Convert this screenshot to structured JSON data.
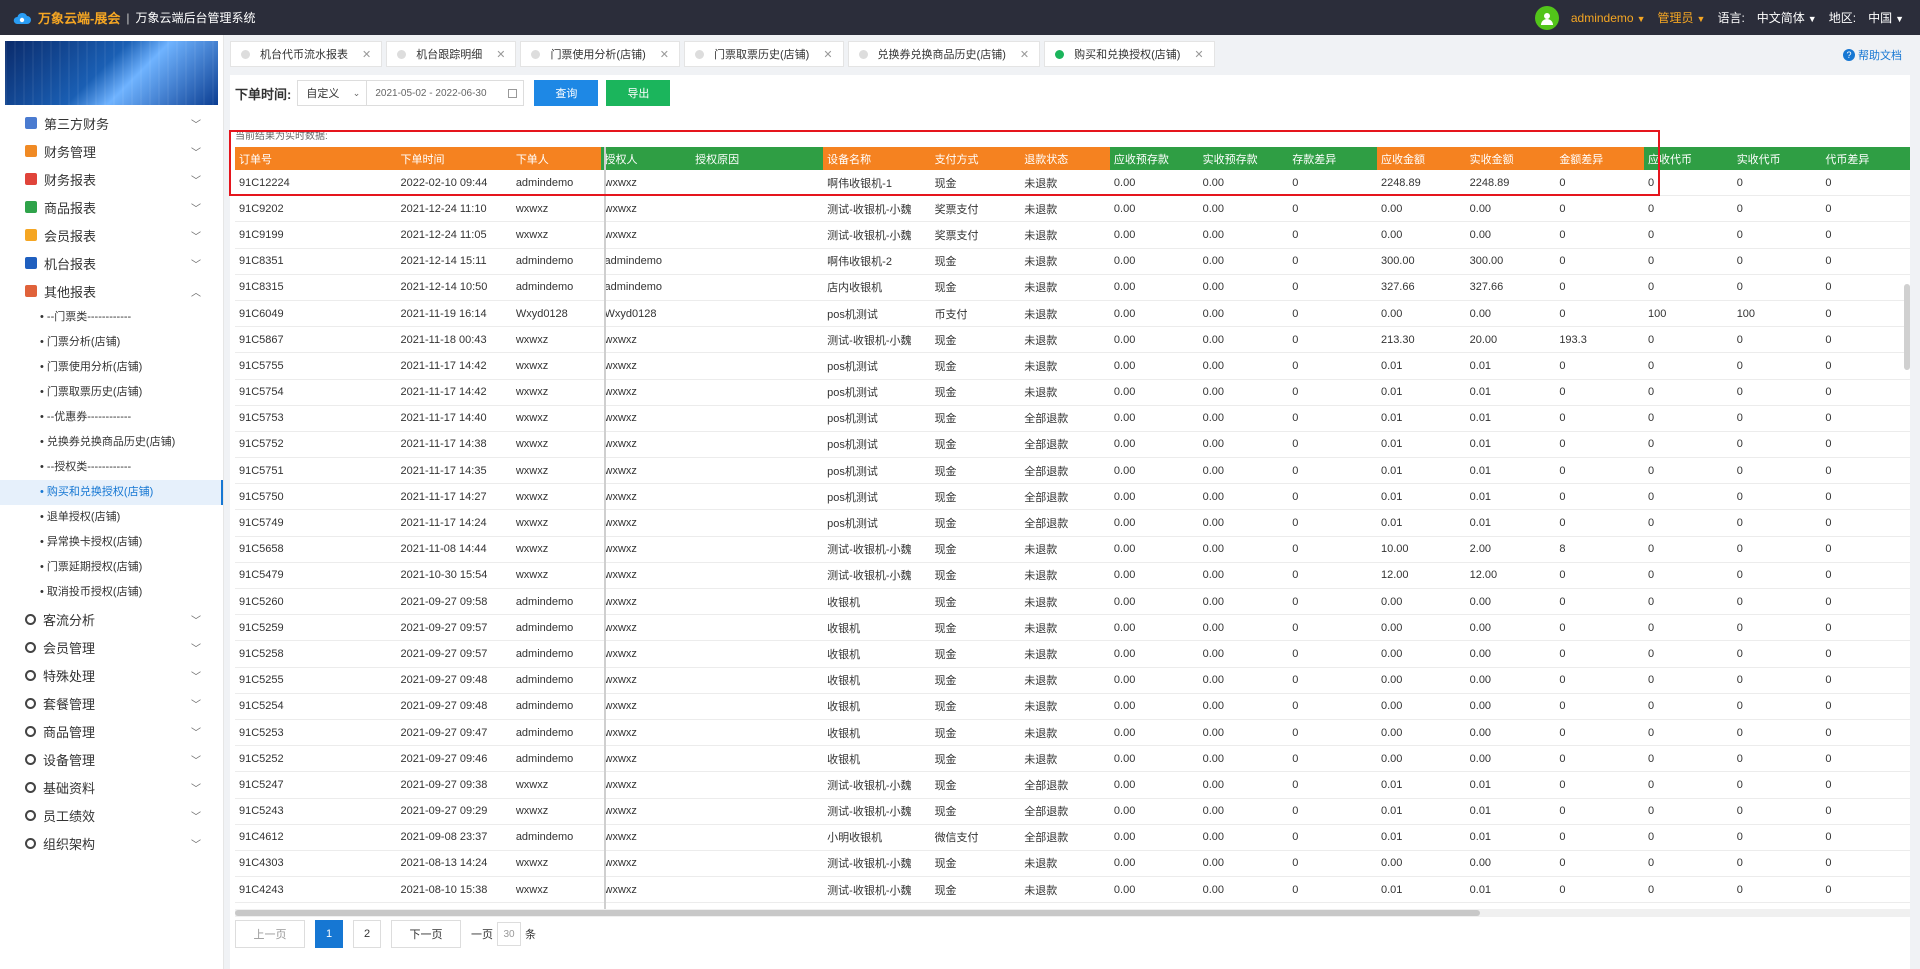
{
  "header": {
    "brand": "万象云端-展会",
    "separator": "|",
    "system_name": "万象云端后台管理系统",
    "username": "admindemo",
    "role": "管理员",
    "language_label": "语言:",
    "language_value": "中文简体",
    "region_label": "地区:",
    "region_value": "中国"
  },
  "sidebar": {
    "menu_top": [
      {
        "label": "第三方财务",
        "icon": "finance-third-icon",
        "color": "#4a7bd0"
      },
      {
        "label": "财务管理",
        "icon": "finance-manage-icon",
        "color": "#f08a24"
      },
      {
        "label": "财务报表",
        "icon": "finance-report-icon",
        "color": "#e0443a"
      },
      {
        "label": "商品报表",
        "icon": "product-report-icon",
        "color": "#2fa34a"
      },
      {
        "label": "会员报表",
        "icon": "member-report-icon",
        "color": "#f5a623"
      },
      {
        "label": "机台报表",
        "icon": "machine-report-icon",
        "color": "#1f5fbf"
      },
      {
        "label": "其他报表",
        "icon": "other-report-icon",
        "color": "#e0623a"
      }
    ],
    "sub_items": [
      {
        "label": "• --门票类------------",
        "active": false
      },
      {
        "label": "• 门票分析(店铺)",
        "active": false
      },
      {
        "label": "• 门票使用分析(店铺)",
        "active": false
      },
      {
        "label": "• 门票取票历史(店铺)",
        "active": false
      },
      {
        "label": "• --优惠券------------",
        "active": false
      },
      {
        "label": "• 兑换券兑换商品历史(店铺)",
        "active": false
      },
      {
        "label": "• --授权类------------",
        "active": false
      },
      {
        "label": "• 购买和兑换授权(店铺)",
        "active": true
      },
      {
        "label": "• 退单授权(店铺)",
        "active": false
      },
      {
        "label": "• 异常换卡授权(店铺)",
        "active": false
      },
      {
        "label": "• 门票延期授权(店铺)",
        "active": false
      },
      {
        "label": "• 取消投币授权(店铺)",
        "active": false
      }
    ],
    "menu_bottom": [
      {
        "label": "客流分析",
        "icon": "traffic-icon"
      },
      {
        "label": "会员管理",
        "icon": "member-icon"
      },
      {
        "label": "特殊处理",
        "icon": "warning-icon"
      },
      {
        "label": "套餐管理",
        "icon": "package-icon"
      },
      {
        "label": "商品管理",
        "icon": "product-icon"
      },
      {
        "label": "设备管理",
        "icon": "device-icon"
      },
      {
        "label": "基础资料",
        "icon": "data-icon"
      },
      {
        "label": "员工绩效",
        "icon": "staff-icon"
      },
      {
        "label": "组织架构",
        "icon": "org-icon"
      }
    ]
  },
  "tabs": [
    {
      "label": "机台代币流水报表",
      "active": false
    },
    {
      "label": "机台跟踪明细",
      "active": false
    },
    {
      "label": "门票使用分析(店铺)",
      "active": false
    },
    {
      "label": "门票取票历史(店铺)",
      "active": false
    },
    {
      "label": "兑换券兑换商品历史(店铺)",
      "active": false
    },
    {
      "label": "购买和兑换授权(店铺)",
      "active": true
    }
  ],
  "help_label": "帮助文档",
  "filter": {
    "label": "下单时间:",
    "mode": "自定义",
    "date_range": "2021-05-02 - 2022-06-30",
    "query_label": "查询",
    "export_label": "导出"
  },
  "note": "当前结果为实时数据:",
  "colors": {
    "orange": "#f58220",
    "green": "#2f9e44",
    "primary": "#1677d3",
    "highlight": "#e5151d"
  },
  "table": {
    "columns": [
      {
        "label": "订单号",
        "color": "o"
      },
      {
        "label": "下单时间",
        "color": "o"
      },
      {
        "label": "下单人",
        "color": "o"
      },
      {
        "label": "授权人",
        "color": "g"
      },
      {
        "label": "授权原因",
        "color": "g"
      },
      {
        "label": "设备名称",
        "color": "o"
      },
      {
        "label": "支付方式",
        "color": "o"
      },
      {
        "label": "退款状态",
        "color": "o"
      },
      {
        "label": "应收预存款",
        "color": "g"
      },
      {
        "label": "实收预存款",
        "color": "g"
      },
      {
        "label": "存款差异",
        "color": "g"
      },
      {
        "label": "应收金额",
        "color": "o"
      },
      {
        "label": "实收金额",
        "color": "o"
      },
      {
        "label": "金额差异",
        "color": "o"
      },
      {
        "label": "应收代币",
        "color": "g"
      },
      {
        "label": "实收代币",
        "color": "g"
      },
      {
        "label": "代币差异",
        "color": "g"
      }
    ],
    "rows": [
      [
        "91C12224",
        "2022-02-10 09:44",
        "admindemo",
        "wxwxz",
        "",
        "啊伟收银机-1",
        "现金",
        "未退款",
        "0.00",
        "0.00",
        "0",
        "2248.89",
        "2248.89",
        "0",
        "0",
        "0",
        "0"
      ],
      [
        "91C9202",
        "2021-12-24 11:10",
        "wxwxz",
        "wxwxz",
        "",
        "测试-收银机-小魏",
        "奖票支付",
        "未退款",
        "0.00",
        "0.00",
        "0",
        "0.00",
        "0.00",
        "0",
        "0",
        "0",
        "0"
      ],
      [
        "91C9199",
        "2021-12-24 11:05",
        "wxwxz",
        "wxwxz",
        "",
        "测试-收银机-小魏",
        "奖票支付",
        "未退款",
        "0.00",
        "0.00",
        "0",
        "0.00",
        "0.00",
        "0",
        "0",
        "0",
        "0"
      ],
      [
        "91C8351",
        "2021-12-14 15:11",
        "admindemo",
        "admindemo",
        "",
        "啊伟收银机-2",
        "现金",
        "未退款",
        "0.00",
        "0.00",
        "0",
        "300.00",
        "300.00",
        "0",
        "0",
        "0",
        "0"
      ],
      [
        "91C8315",
        "2021-12-14 10:50",
        "admindemo",
        "admindemo",
        "",
        "店内收银机",
        "现金",
        "未退款",
        "0.00",
        "0.00",
        "0",
        "327.66",
        "327.66",
        "0",
        "0",
        "0",
        "0"
      ],
      [
        "91C6049",
        "2021-11-19 16:14",
        "Wxyd0128",
        "Wxyd0128",
        "",
        "pos机测试",
        "币支付",
        "未退款",
        "0.00",
        "0.00",
        "0",
        "0.00",
        "0.00",
        "0",
        "100",
        "100",
        "0"
      ],
      [
        "91C5867",
        "2021-11-18 00:43",
        "wxwxz",
        "wxwxz",
        "",
        "测试-收银机-小魏",
        "现金",
        "未退款",
        "0.00",
        "0.00",
        "0",
        "213.30",
        "20.00",
        "193.3",
        "0",
        "0",
        "0"
      ],
      [
        "91C5755",
        "2021-11-17 14:42",
        "wxwxz",
        "wxwxz",
        "",
        "pos机测试",
        "现金",
        "未退款",
        "0.00",
        "0.00",
        "0",
        "0.01",
        "0.01",
        "0",
        "0",
        "0",
        "0"
      ],
      [
        "91C5754",
        "2021-11-17 14:42",
        "wxwxz",
        "wxwxz",
        "",
        "pos机测试",
        "现金",
        "未退款",
        "0.00",
        "0.00",
        "0",
        "0.01",
        "0.01",
        "0",
        "0",
        "0",
        "0"
      ],
      [
        "91C5753",
        "2021-11-17 14:40",
        "wxwxz",
        "wxwxz",
        "",
        "pos机测试",
        "现金",
        "全部退款",
        "0.00",
        "0.00",
        "0",
        "0.01",
        "0.01",
        "0",
        "0",
        "0",
        "0"
      ],
      [
        "91C5752",
        "2021-11-17 14:38",
        "wxwxz",
        "wxwxz",
        "",
        "pos机测试",
        "现金",
        "全部退款",
        "0.00",
        "0.00",
        "0",
        "0.01",
        "0.01",
        "0",
        "0",
        "0",
        "0"
      ],
      [
        "91C5751",
        "2021-11-17 14:35",
        "wxwxz",
        "wxwxz",
        "",
        "pos机测试",
        "现金",
        "全部退款",
        "0.00",
        "0.00",
        "0",
        "0.01",
        "0.01",
        "0",
        "0",
        "0",
        "0"
      ],
      [
        "91C5750",
        "2021-11-17 14:27",
        "wxwxz",
        "wxwxz",
        "",
        "pos机测试",
        "现金",
        "全部退款",
        "0.00",
        "0.00",
        "0",
        "0.01",
        "0.01",
        "0",
        "0",
        "0",
        "0"
      ],
      [
        "91C5749",
        "2021-11-17 14:24",
        "wxwxz",
        "wxwxz",
        "",
        "pos机测试",
        "现金",
        "全部退款",
        "0.00",
        "0.00",
        "0",
        "0.01",
        "0.01",
        "0",
        "0",
        "0",
        "0"
      ],
      [
        "91C5658",
        "2021-11-08 14:44",
        "wxwxz",
        "wxwxz",
        "",
        "测试-收银机-小魏",
        "现金",
        "未退款",
        "0.00",
        "0.00",
        "0",
        "10.00",
        "2.00",
        "8",
        "0",
        "0",
        "0"
      ],
      [
        "91C5479",
        "2021-10-30 15:54",
        "wxwxz",
        "wxwxz",
        "",
        "测试-收银机-小魏",
        "现金",
        "未退款",
        "0.00",
        "0.00",
        "0",
        "12.00",
        "12.00",
        "0",
        "0",
        "0",
        "0"
      ],
      [
        "91C5260",
        "2021-09-27 09:58",
        "admindemo",
        "wxwxz",
        "",
        "收银机",
        "现金",
        "未退款",
        "0.00",
        "0.00",
        "0",
        "0.00",
        "0.00",
        "0",
        "0",
        "0",
        "0"
      ],
      [
        "91C5259",
        "2021-09-27 09:57",
        "admindemo",
        "wxwxz",
        "",
        "收银机",
        "现金",
        "未退款",
        "0.00",
        "0.00",
        "0",
        "0.00",
        "0.00",
        "0",
        "0",
        "0",
        "0"
      ],
      [
        "91C5258",
        "2021-09-27 09:57",
        "admindemo",
        "wxwxz",
        "",
        "收银机",
        "现金",
        "未退款",
        "0.00",
        "0.00",
        "0",
        "0.00",
        "0.00",
        "0",
        "0",
        "0",
        "0"
      ],
      [
        "91C5255",
        "2021-09-27 09:48",
        "admindemo",
        "wxwxz",
        "",
        "收银机",
        "现金",
        "未退款",
        "0.00",
        "0.00",
        "0",
        "0.00",
        "0.00",
        "0",
        "0",
        "0",
        "0"
      ],
      [
        "91C5254",
        "2021-09-27 09:48",
        "admindemo",
        "wxwxz",
        "",
        "收银机",
        "现金",
        "未退款",
        "0.00",
        "0.00",
        "0",
        "0.00",
        "0.00",
        "0",
        "0",
        "0",
        "0"
      ],
      [
        "91C5253",
        "2021-09-27 09:47",
        "admindemo",
        "wxwxz",
        "",
        "收银机",
        "现金",
        "未退款",
        "0.00",
        "0.00",
        "0",
        "0.00",
        "0.00",
        "0",
        "0",
        "0",
        "0"
      ],
      [
        "91C5252",
        "2021-09-27 09:46",
        "admindemo",
        "wxwxz",
        "",
        "收银机",
        "现金",
        "未退款",
        "0.00",
        "0.00",
        "0",
        "0.00",
        "0.00",
        "0",
        "0",
        "0",
        "0"
      ],
      [
        "91C5247",
        "2021-09-27 09:38",
        "wxwxz",
        "wxwxz",
        "",
        "测试-收银机-小魏",
        "现金",
        "全部退款",
        "0.00",
        "0.00",
        "0",
        "0.01",
        "0.01",
        "0",
        "0",
        "0",
        "0"
      ],
      [
        "91C5243",
        "2021-09-27 09:29",
        "wxwxz",
        "wxwxz",
        "",
        "测试-收银机-小魏",
        "现金",
        "全部退款",
        "0.00",
        "0.00",
        "0",
        "0.01",
        "0.01",
        "0",
        "0",
        "0",
        "0"
      ],
      [
        "91C4612",
        "2021-09-08 23:37",
        "admindemo",
        "wxwxz",
        "",
        "小明收银机",
        "微信支付",
        "全部退款",
        "0.00",
        "0.00",
        "0",
        "0.01",
        "0.01",
        "0",
        "0",
        "0",
        "0"
      ],
      [
        "91C4303",
        "2021-08-13 14:24",
        "wxwxz",
        "wxwxz",
        "",
        "测试-收银机-小魏",
        "现金",
        "未退款",
        "0.00",
        "0.00",
        "0",
        "0.00",
        "0.00",
        "0",
        "0",
        "0",
        "0"
      ],
      [
        "91C4243",
        "2021-08-10 15:38",
        "wxwxz",
        "wxwxz",
        "",
        "测试-收银机-小魏",
        "现金",
        "未退款",
        "0.00",
        "0.00",
        "0",
        "0.01",
        "0.01",
        "0",
        "0",
        "0",
        "0"
      ]
    ]
  },
  "pager": {
    "prev_label": "上一页",
    "pages": [
      "1",
      "2"
    ],
    "current": "1",
    "next_label": "下一页",
    "size_prefix": "一页",
    "size_value": "30",
    "size_suffix": "条"
  }
}
